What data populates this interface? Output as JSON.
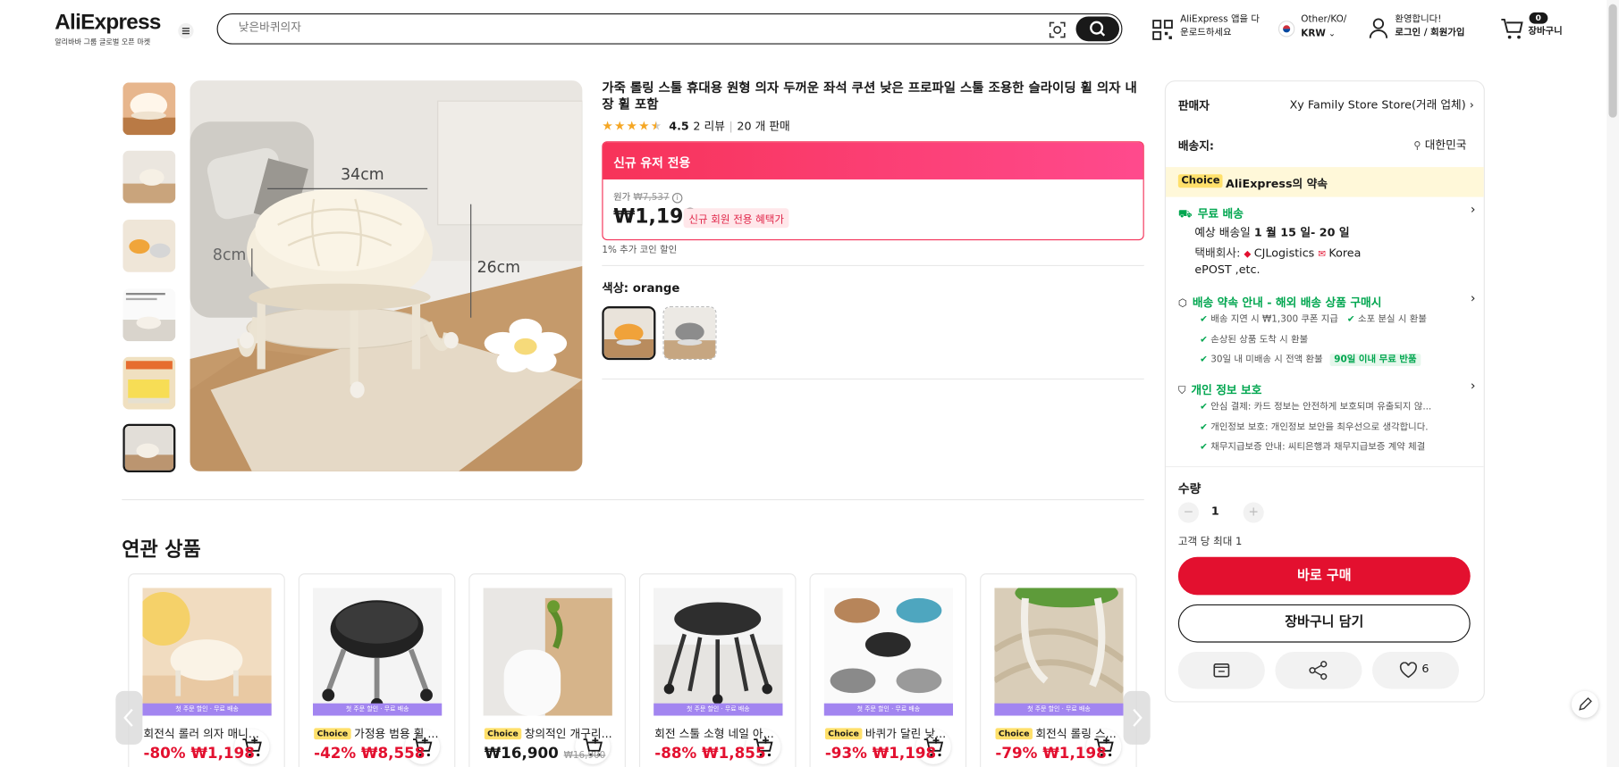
{
  "header": {
    "logo": "AliExpress",
    "logo_sub": "알리바바 그룹 글로벌 오픈 마켓",
    "search_placeholder": "낮은바퀴의자",
    "app_line1": "AliExpress 앱을 다",
    "app_line2": "운로드하세요",
    "locale_line1": "Other/KO/",
    "currency": "KRW",
    "welcome": "환영합니다!",
    "login": "로그인 / 회원가입",
    "cart_count": "0",
    "cart_label": "장바구니"
  },
  "product": {
    "title": "가죽 롤링 스툴 휴대용 원형 의자 두꺼운 좌석 쿠션 낮은 프로파일 스툴 조용한 슬라이딩 휠 의자 내장 휠 포함",
    "rating": "4.5",
    "reviews": "2 리뷰",
    "sold": "20 개 판매",
    "star_rating": 4.5,
    "image_labels": {
      "width": "34cm",
      "depth": "8cm",
      "height": "26cm"
    }
  },
  "promo": {
    "header": "신규 유저 전용",
    "orig_label": "원가",
    "orig_price": "₩7,537",
    "price": "₩1,198",
    "badge": "신규 회원 전용 혜택가",
    "coin": "1% 추가 코인 할인"
  },
  "color": {
    "label": "색상:",
    "value": "orange"
  },
  "panel": {
    "seller_label": "판매자",
    "seller": "Xy Family Store Store(거래 업체)",
    "ship_label": "배송지:",
    "ship_to": "대한민국",
    "choice": "Choice",
    "promise": "AliExpress의 약속",
    "free_ship": "무료 배송",
    "eta_prefix": "예상 배송일",
    "eta": "1 월 15 일- 20 일",
    "carrier_label": "택배회사:",
    "carrier1": "CJLogistics",
    "carrier2": "Korea",
    "carrier3": "ePOST ,etc.",
    "commit_title": "배송 약속 안내 - 해외 배송 상품 구매시",
    "commit1": "배송 지연 시 ₩1,300 쿠폰 지급",
    "commit2": "소포 분실 시 환불",
    "commit3": "손상된 상품 도착 시 환불",
    "commit4": "30일 내 미배송 시 전액 환불",
    "commit_badge": "90일 이내 무료 반품",
    "privacy_title": "개인 정보 보호",
    "priv1": "안심 결제: 카드 정보는 안전하게 보호되며 유출되지 않...",
    "priv2": "개인정보 보호: 개인정보 보안을 최우선으로 생각합니다.",
    "priv3": "채무지급보증 안내: 씨티은행과 채무지급보증 계약 체결",
    "qty_label": "수량",
    "qty": "1",
    "limit": "고객 당 최대 1",
    "buy_now": "바로 구매",
    "add_cart": "장바구니 담기",
    "wish_count": "6"
  },
  "related": {
    "title": "연관 상품",
    "band": "첫 주문 할인 · 무료 배송",
    "items": [
      {
        "choice": "",
        "name": "회전식 롤러 의자 매니...",
        "discount": "-80%",
        "price": "₩1,198",
        "orig": ""
      },
      {
        "choice": "Choice",
        "name": "가정용 범용 휠 ...",
        "discount": "-42%",
        "price": "₩8,558",
        "orig": ""
      },
      {
        "choice": "Choice",
        "name": "창의적인 개구리...",
        "discount": "",
        "price": "₩16,900",
        "orig": "₩16,900"
      },
      {
        "choice": "",
        "name": "회전 스툴 소형 네일 아...",
        "discount": "-88%",
        "price": "₩1,855",
        "orig": ""
      },
      {
        "choice": "Choice",
        "name": "바퀴가 달린 낮...",
        "discount": "-93%",
        "price": "₩1,198",
        "orig": ""
      },
      {
        "choice": "Choice",
        "name": "회전식 롤링 스...",
        "discount": "-79%",
        "price": "₩1,198",
        "orig": ""
      }
    ]
  },
  "colors": {
    "accent": "#e3102f",
    "promo": "#f73359",
    "green": "#00a64f",
    "choice": "#ffe06b",
    "band": "#a285f0"
  }
}
